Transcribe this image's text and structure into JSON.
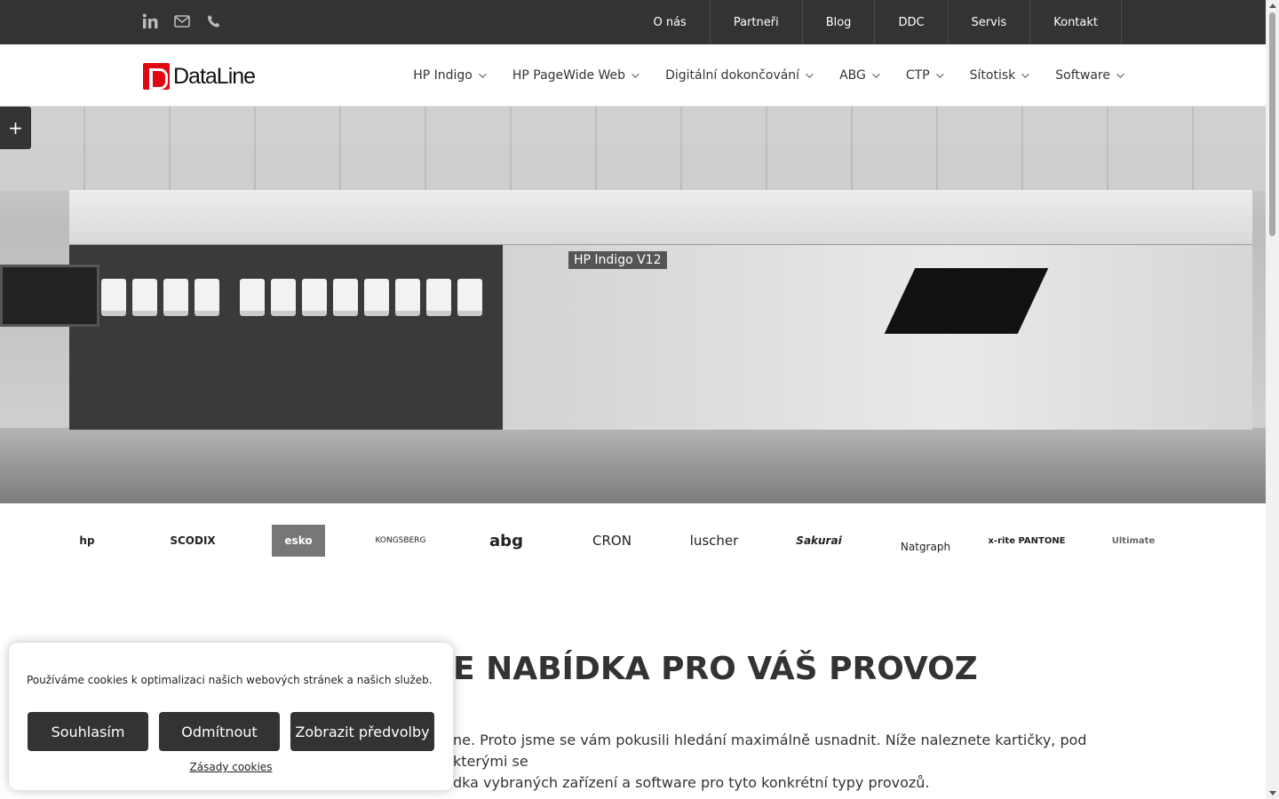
{
  "topbar": {
    "social": [
      {
        "icon": "linkedin-icon"
      },
      {
        "icon": "mail-icon"
      },
      {
        "icon": "phone-icon"
      }
    ],
    "links": [
      "O nás",
      "Partneři",
      "Blog",
      "DDC",
      "Servis",
      "Kontakt"
    ]
  },
  "header": {
    "logo_text": "DataLine",
    "nav": [
      "HP Indigo",
      "HP PageWide Web",
      "Digitální dokončování",
      "ABG",
      "CTP",
      "Sítotisk",
      "Software"
    ]
  },
  "hero": {
    "model_label": "HP Indigo V12"
  },
  "sidebar_toggle": "+",
  "partners": [
    "hp",
    "SCODIX",
    "esko",
    "KONGSBERG",
    "abg",
    "CRON",
    "luscher",
    "Sakurai",
    "Natgraph",
    "x-rite PANTONE",
    "Ultimate"
  ],
  "section": {
    "title_bold": "E NABÍDKA",
    "title_rest": " PRO VÁŠ PROVOZ",
    "intro_line1": "ne. Proto jsme se vám pokusili hledání maximálně usnadnit. Níže naleznete kartičky, pod kterými se",
    "intro_line2": "dka vybraných zařízení a software pro tyto konkrétní typy provozů."
  },
  "cookie": {
    "message": "Používáme cookies k optimalizaci našich webových stránek a našich služeb.",
    "accept": "Souhlasím",
    "reject": "Odmítnout",
    "preferences": "Zobrazit předvolby",
    "policy": "Zásady cookies"
  },
  "colors": {
    "topbar": "#333333",
    "brand_red": "#e30613",
    "button": "#333333"
  }
}
